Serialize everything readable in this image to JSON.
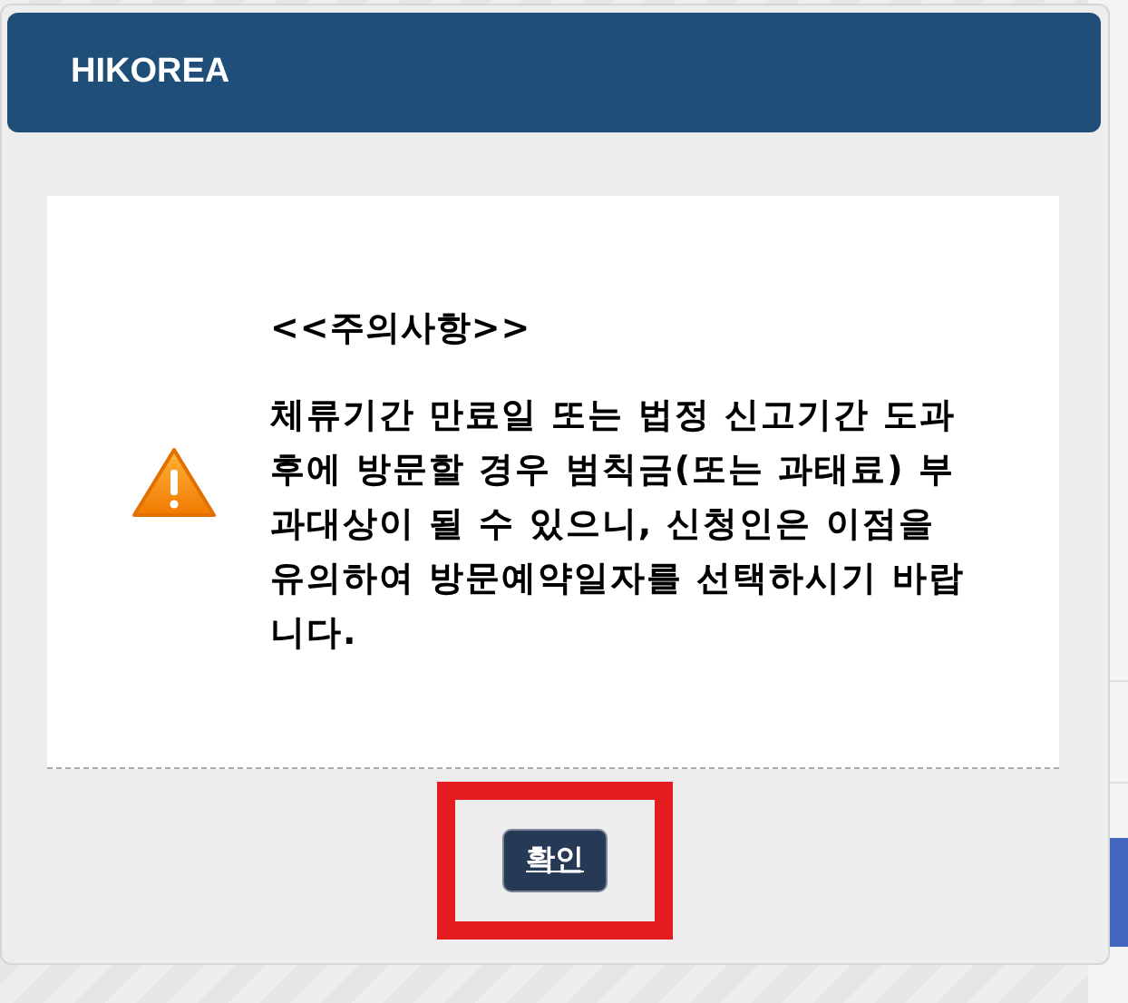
{
  "dialog": {
    "title": "HIKOREA",
    "heading": "<<주의사항>>",
    "message": "체류기간 만료일 또는 법정 신고기간 도과 후에 방문할 경우 범칙금(또는 과태료) 부과대상이 될 수 있으니, 신청인은 이점을 유의하여 방문예약일자를 선택하시기 바랍니다.",
    "confirm_button": {
      "label": "확인",
      "highlighted": true
    }
  }
}
